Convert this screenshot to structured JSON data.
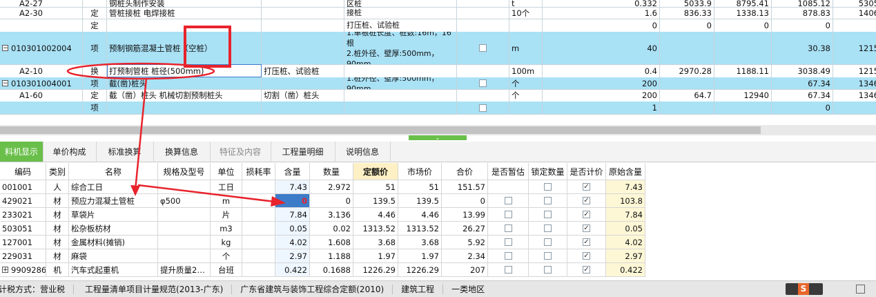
{
  "top_rows": [
    {
      "code": "A2-27",
      "type": "",
      "name": "钢桩头制作安装",
      "feature": "",
      "item": "区桩",
      "unit": "t",
      "qty": "0.332",
      "p1": "5033.9",
      "p2": "8795.41",
      "p3": "1085.12",
      "p4": "5305"
    },
    {
      "code": "A2-30",
      "type": "定",
      "name": "管桩接桩 电焊接桩",
      "feature": "",
      "item": "接桩",
      "unit": "10个",
      "qty": "1.6",
      "p1": "836.33",
      "p2": "1338.13",
      "p3": "878.83",
      "p4": "1406"
    },
    {
      "code": "",
      "type": "定",
      "name": "",
      "feature": "",
      "item": "打压桩、试验桩",
      "unit": "",
      "qty": "0",
      "p1": "0",
      "p2": "0",
      "p3": "0",
      "p4": ""
    },
    {
      "code": "010301002004",
      "type": "项",
      "name": "预制钢筋混凝土管桩（空桩）",
      "feature": "",
      "item": "1.单根桩长度、桩数:16m，16根\n2.桩外径、壁厚:500mm，90mm",
      "unit": "m",
      "qty": "40",
      "p1": "",
      "p2": "",
      "p3": "30.38",
      "p4": "1215"
    },
    {
      "code": "A2-10",
      "type": "换",
      "name": "打预制管桩 桩径(500mm)",
      "feature": "打压桩、试验桩",
      "item": "",
      "unit": "100m",
      "qty": "0.4",
      "p1": "2970.28",
      "p2": "1188.11",
      "p3": "3038.49",
      "p4": "1215"
    },
    {
      "code": "010301004001",
      "type": "项",
      "name": "截(凿)桩头",
      "feature": "",
      "item": "1.桩外径、壁厚:500mm，90mm",
      "unit": "个",
      "qty": "200",
      "p1": "",
      "p2": "",
      "p3": "67.34",
      "p4": "1346"
    },
    {
      "code": "A1-60",
      "type": "定",
      "name": "截（凿）桩头 机械切割预制桩头",
      "feature": "切割（凿）桩头",
      "item": "",
      "unit": "个",
      "qty": "200",
      "p1": "64.7",
      "p2": "12940",
      "p3": "67.34",
      "p4": "1346"
    },
    {
      "code": "",
      "type": "项",
      "name": "",
      "feature": "",
      "item": "",
      "unit": "",
      "qty": "1",
      "p1": "",
      "p2": "",
      "p3": "0",
      "p4": ""
    }
  ],
  "tabs": [
    "料机显示",
    "单价构成",
    "标准换算",
    "换算信息",
    "特征及内容",
    "工程量明细",
    "说明信息"
  ],
  "lower_headers": [
    "编码",
    "类别",
    "名称",
    "规格及型号",
    "单位",
    "损耗率",
    "含量",
    "数量",
    "定额价",
    "市场价",
    "合价",
    "是否暂估",
    "锁定数量",
    "是否计价",
    "原始含量"
  ],
  "lower_rows": [
    {
      "code": "001001",
      "type": "人",
      "name": "综合工日",
      "spec": "",
      "unit": "工日",
      "loss": "",
      "content": "7.43",
      "qty": "2.972",
      "quota": "51",
      "market": "51",
      "total": "151.57",
      "est": false,
      "lock": false,
      "price": true,
      "orig": "7.43"
    },
    {
      "code": "429021",
      "type": "材",
      "name": "预应力混凝土管桩",
      "spec": "φ500",
      "unit": "m",
      "loss": "",
      "content": "0",
      "qty": "0",
      "quota": "139.5",
      "market": "139.5",
      "total": "0",
      "est": false,
      "lock": false,
      "price": true,
      "orig": "103.8"
    },
    {
      "code": "233021",
      "type": "材",
      "name": "草袋片",
      "spec": "",
      "unit": "片",
      "loss": "",
      "content": "7.84",
      "qty": "3.136",
      "quota": "4.46",
      "market": "4.46",
      "total": "13.99",
      "est": false,
      "lock": false,
      "price": true,
      "orig": "7.84"
    },
    {
      "code": "503051",
      "type": "材",
      "name": "松杂板枋材",
      "spec": "",
      "unit": "m3",
      "loss": "",
      "content": "0.05",
      "qty": "0.02",
      "quota": "1313.52",
      "market": "1313.52",
      "total": "26.27",
      "est": false,
      "lock": false,
      "price": true,
      "orig": "0.05"
    },
    {
      "code": "127001",
      "type": "材",
      "name": "金属材料(摊销)",
      "spec": "",
      "unit": "kg",
      "loss": "",
      "content": "4.02",
      "qty": "1.608",
      "quota": "3.68",
      "market": "3.68",
      "total": "5.92",
      "est": false,
      "lock": false,
      "price": true,
      "orig": "4.02"
    },
    {
      "code": "229031",
      "type": "材",
      "name": "麻袋",
      "spec": "",
      "unit": "个",
      "loss": "",
      "content": "2.97",
      "qty": "1.188",
      "quota": "1.97",
      "market": "1.97",
      "total": "2.34",
      "est": false,
      "lock": false,
      "price": true,
      "orig": "2.97"
    },
    {
      "code": "9909286",
      "type": "机",
      "name": "汽车式起重机",
      "spec": "提升质量2…",
      "unit": "台班",
      "loss": "",
      "content": "0.422",
      "qty": "0.1688",
      "quota": "1226.29",
      "market": "1226.29",
      "total": "207",
      "est": false,
      "lock": false,
      "price": true,
      "orig": "0.422"
    }
  ],
  "status": [
    "计税方式：营业税",
    "工程量清单项目计量规范(2013-广东)",
    "广东省建筑与装饰工程综合定额(2010)",
    "建筑工程",
    "一类地区"
  ],
  "colors": {
    "blue_row": "#a9e1f5",
    "accent_green": "#6abf4b",
    "annotation_red": "#e8232c"
  }
}
